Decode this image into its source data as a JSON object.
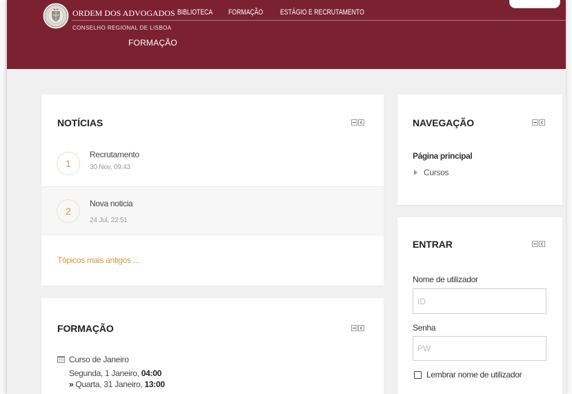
{
  "header": {
    "org_name": "ORDEM DOS ADVOGADOS",
    "org_subtitle": "CONSELHO REGIONAL DE LISBOA",
    "site_name": "FORMAÇÃO",
    "nav": [
      {
        "label": "BIBLIOTECA"
      },
      {
        "label": "FORMAÇÃO"
      },
      {
        "label": "ESTÁGIO E RECRUTAMENTO"
      }
    ]
  },
  "news": {
    "title": "NOTÍCIAS",
    "items": [
      {
        "number": "1",
        "title": "Recrutamento",
        "date": "30 Nov, 09:43"
      },
      {
        "number": "2",
        "title": "Nova noticia",
        "date": "24 Jul, 22:51"
      }
    ],
    "older_link": "Tópicos mais antigos ..."
  },
  "training": {
    "title": "FORMAÇÃO",
    "events": [
      {
        "name": "Curso de Janeiro",
        "start_date": "Segunda, 1 Janeiro,",
        "start_time": "04:00",
        "end_marker": "»",
        "end_date": "Quarta, 31 Janeiro,",
        "end_time": "13:00"
      }
    ]
  },
  "navigation": {
    "title": "NAVEGAÇÃO",
    "home": "Página principal",
    "items": [
      {
        "label": "Cursos",
        "expanded": false
      }
    ]
  },
  "login": {
    "title": "ENTRAR",
    "username_label": "Nome de utilizador",
    "username_value": "",
    "username_placeholder": "ID",
    "password_label": "Senha",
    "password_value": "",
    "password_placeholder": "PW",
    "remember_label": "Lembrar nome de utilizador",
    "remember_checked": false
  },
  "icons": {
    "logo": "ordem-dos-advogados-seal",
    "block_hide": "minus-box-icon",
    "block_dock": "chevron-left-box-icon",
    "event": "calendar-icon",
    "tree_collapsed": "triangle-right-icon"
  },
  "colors": {
    "header_bg": "#7b2131",
    "accent": "#d6963a",
    "page_bg": "#f0f0f0",
    "card_bg": "#ffffff",
    "text": "#333333",
    "muted": "#9a9a9a"
  }
}
